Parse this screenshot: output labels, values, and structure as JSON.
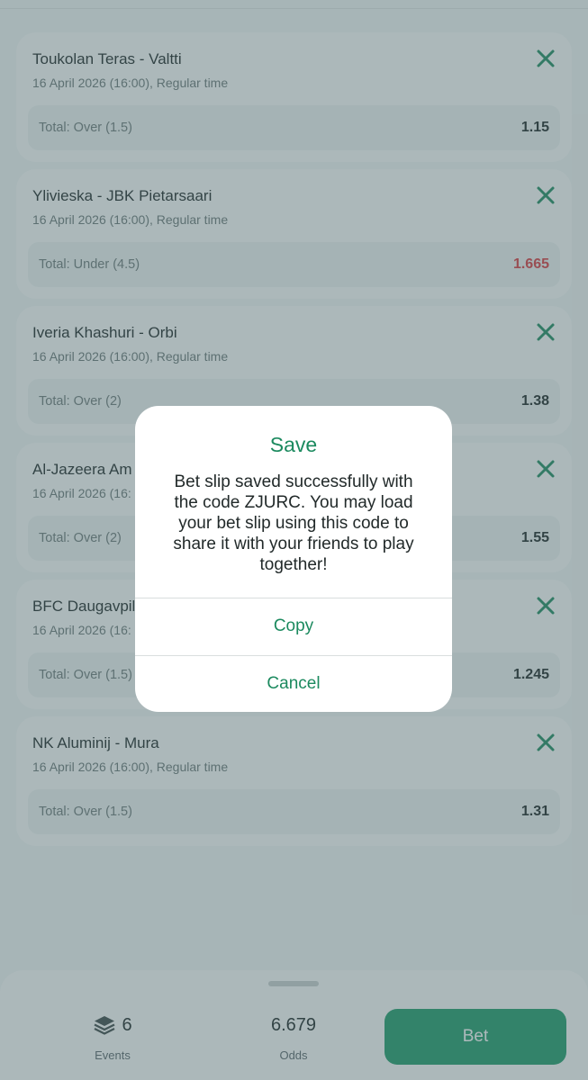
{
  "colors": {
    "accent": "#1c8a5f",
    "bet_button": "#1c9a68",
    "odds_down": "#d8393d",
    "overlay": "rgba(78,104,108,0.46)"
  },
  "bets": [
    {
      "match": "Toukolan Teras - Valtti",
      "date": "16 April 2026 (16:00), Regular time",
      "market": "Total: Over (1.5)",
      "odds": "1.15",
      "odds_changed": false
    },
    {
      "match": "Ylivieska - JBK Pietarsaari",
      "date": "16 April 2026 (16:00), Regular time",
      "market": "Total: Under (4.5)",
      "odds": "1.665",
      "odds_changed": true
    },
    {
      "match": "Iveria Khashuri - Orbi",
      "date": "16 April 2026 (16:00), Regular time",
      "market": "Total: Over (2)",
      "odds": "1.38",
      "odds_changed": false
    },
    {
      "match": "Al-Jazeera Am",
      "date": "16 April 2026 (16:",
      "market": "Total: Over (2)",
      "odds": "1.55",
      "odds_changed": false
    },
    {
      "match": "BFC Daugavpils",
      "date": "16 April 2026 (16:",
      "market": "Total: Over (1.5)",
      "odds": "1.245",
      "odds_changed": false
    },
    {
      "match": "NK Aluminij - Mura",
      "date": "16 April 2026 (16:00), Regular time",
      "market": "Total: Over (1.5)",
      "odds": "1.31",
      "odds_changed": false
    }
  ],
  "icons": {
    "remove": "close-icon",
    "events": "layers-icon"
  },
  "footer": {
    "events_count": "6",
    "events_label": "Events",
    "odds_value": "6.679",
    "odds_label": "Odds",
    "bet_label": "Bet"
  },
  "dialog": {
    "title": "Save",
    "message": "Bet slip saved successfully with the code ZJURC. You may load your bet slip using this code to share it with your friends to play together!",
    "copy_label": "Copy",
    "cancel_label": "Cancel"
  }
}
